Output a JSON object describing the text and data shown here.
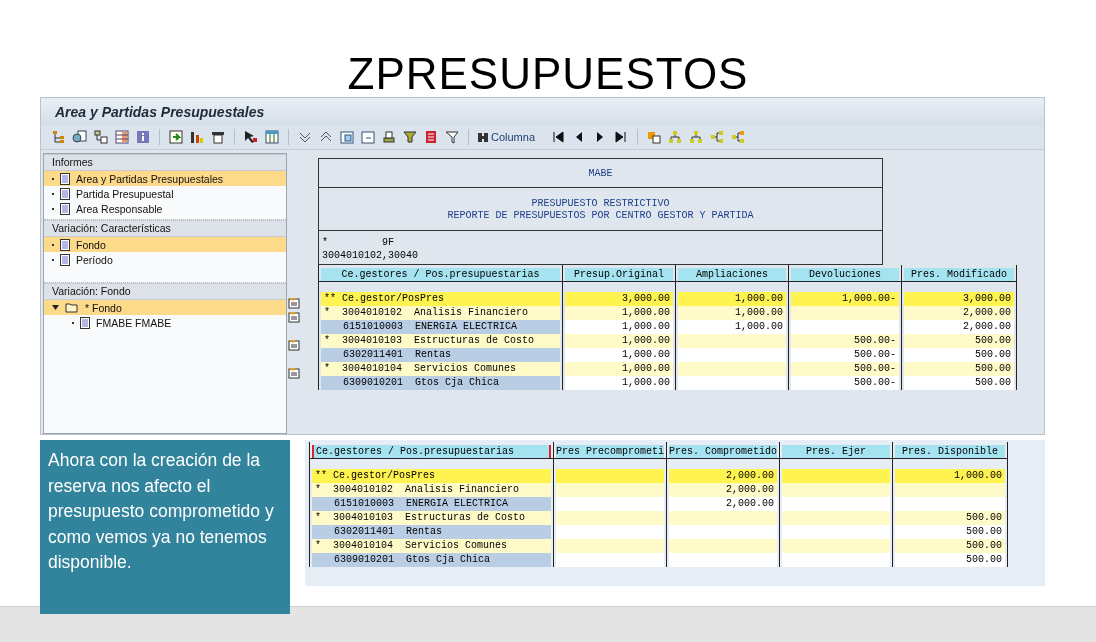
{
  "slide": {
    "title": "ZPRESUPUESTOS",
    "note": "Ahora con la creación de la reserva nos afecto el presupuesto comprometido y como vemos ya no tenemos disponible."
  },
  "window": {
    "title": "Area y Partidas Presupuestales",
    "column_button": "Columna"
  },
  "sidebar": {
    "sections": [
      {
        "title": "Informes",
        "items": [
          {
            "label": "Area y Partidas Presupuestales",
            "selected": true
          },
          {
            "label": "Partida Presupuestal",
            "selected": false
          },
          {
            "label": "Area Responsable",
            "selected": false
          }
        ]
      },
      {
        "title": "Variación: Características",
        "items": [
          {
            "label": "Fondo",
            "selected": true
          },
          {
            "label": "Período",
            "selected": false
          }
        ]
      },
      {
        "title": "Variación: Fondo",
        "items": [
          {
            "label": "* Fondo",
            "selected": true,
            "expanded": true,
            "children": [
              {
                "label": "FMABE FMABE",
                "selected": false
              }
            ]
          }
        ]
      }
    ]
  },
  "report": {
    "company": "MABE",
    "lines": [
      "PRESUPUESTO RESTRICTIVO",
      "REPORTE DE PRESUPUESTOS POR CENTRO GESTOR Y PARTIDA"
    ],
    "selection_marker": "*",
    "selection_value": "9F",
    "selection_range": "3004010102,30040",
    "table": {
      "columns": [
        "Ce.gestores / Pos.presupuestarias",
        "Presup.Original",
        "Ampliaciones",
        "Devoluciones",
        "Pres. Modificado"
      ],
      "rows": [
        {
          "kind": "total",
          "marker": "**",
          "name": "Ce.gestor/PosPres",
          "values": {
            "col_1": "3,000.00",
            "col_2": "1,000.00",
            "col_3": "1,000.00-",
            "col_4": "3,000.00"
          }
        },
        {
          "kind": "group",
          "marker": "*",
          "code": "3004010102",
          "name": "Analisis Financiero",
          "values": {
            "col_1": "1,000.00",
            "col_2": "1,000.00",
            "col_4": "2,000.00"
          }
        },
        {
          "kind": "item",
          "code": "6151010003",
          "name": "ENERGIA ELECTRICA",
          "values": {
            "col_1": "1,000.00",
            "col_2": "1,000.00",
            "col_4": "2,000.00"
          }
        },
        {
          "kind": "group",
          "marker": "*",
          "code": "3004010103",
          "name": "Estructuras de Costo",
          "values": {
            "col_1": "1,000.00",
            "col_3": "500.00-",
            "col_4": "500.00"
          }
        },
        {
          "kind": "item",
          "code": "6302011401",
          "name": "Rentas",
          "values": {
            "col_1": "1,000.00",
            "col_3": "500.00-",
            "col_4": "500.00"
          }
        },
        {
          "kind": "group",
          "marker": "*",
          "code": "3004010104",
          "name": "Servicios Comunes",
          "values": {
            "col_1": "1,000.00",
            "col_3": "500.00-",
            "col_4": "500.00"
          }
        },
        {
          "kind": "item",
          "code": "6309010201",
          "name": "Gtos Cja Chica",
          "values": {
            "col_1": "1,000.00",
            "col_3": "500.00-",
            "col_4": "500.00"
          }
        }
      ]
    }
  },
  "table_2": {
    "columns": [
      "Ce.gestores / Pos.presupuestarias",
      "Pres Precomprometi",
      "Pres. Comprometido",
      "Pres. Ejer",
      "Pres. Disponible"
    ],
    "rows": [
      {
        "kind": "total",
        "marker": "**",
        "name": "Ce.gestor/PosPres",
        "values": {
          "col_2": "2,000.00",
          "col_4": "1,000.00"
        }
      },
      {
        "kind": "group",
        "marker": "*",
        "code": "3004010102",
        "name": "Analisis Financiero",
        "values": {
          "col_2": "2,000.00"
        }
      },
      {
        "kind": "item",
        "code": "6151010003",
        "name": "ENERGIA ELECTRICA",
        "values": {
          "col_2": "2,000.00"
        }
      },
      {
        "kind": "group",
        "marker": "*",
        "code": "3004010103",
        "name": "Estructuras de Costo",
        "values": {
          "col_4": "500.00"
        }
      },
      {
        "kind": "item",
        "code": "6302011401",
        "name": "Rentas",
        "values": {
          "col_4": "500.00"
        }
      },
      {
        "kind": "group",
        "marker": "*",
        "code": "3004010104",
        "name": "Servicios Comunes",
        "values": {
          "col_4": "500.00"
        }
      },
      {
        "kind": "item",
        "code": "6309010201",
        "name": "Gtos Cja Chica",
        "values": {
          "col_4": "500.00"
        }
      }
    ]
  }
}
